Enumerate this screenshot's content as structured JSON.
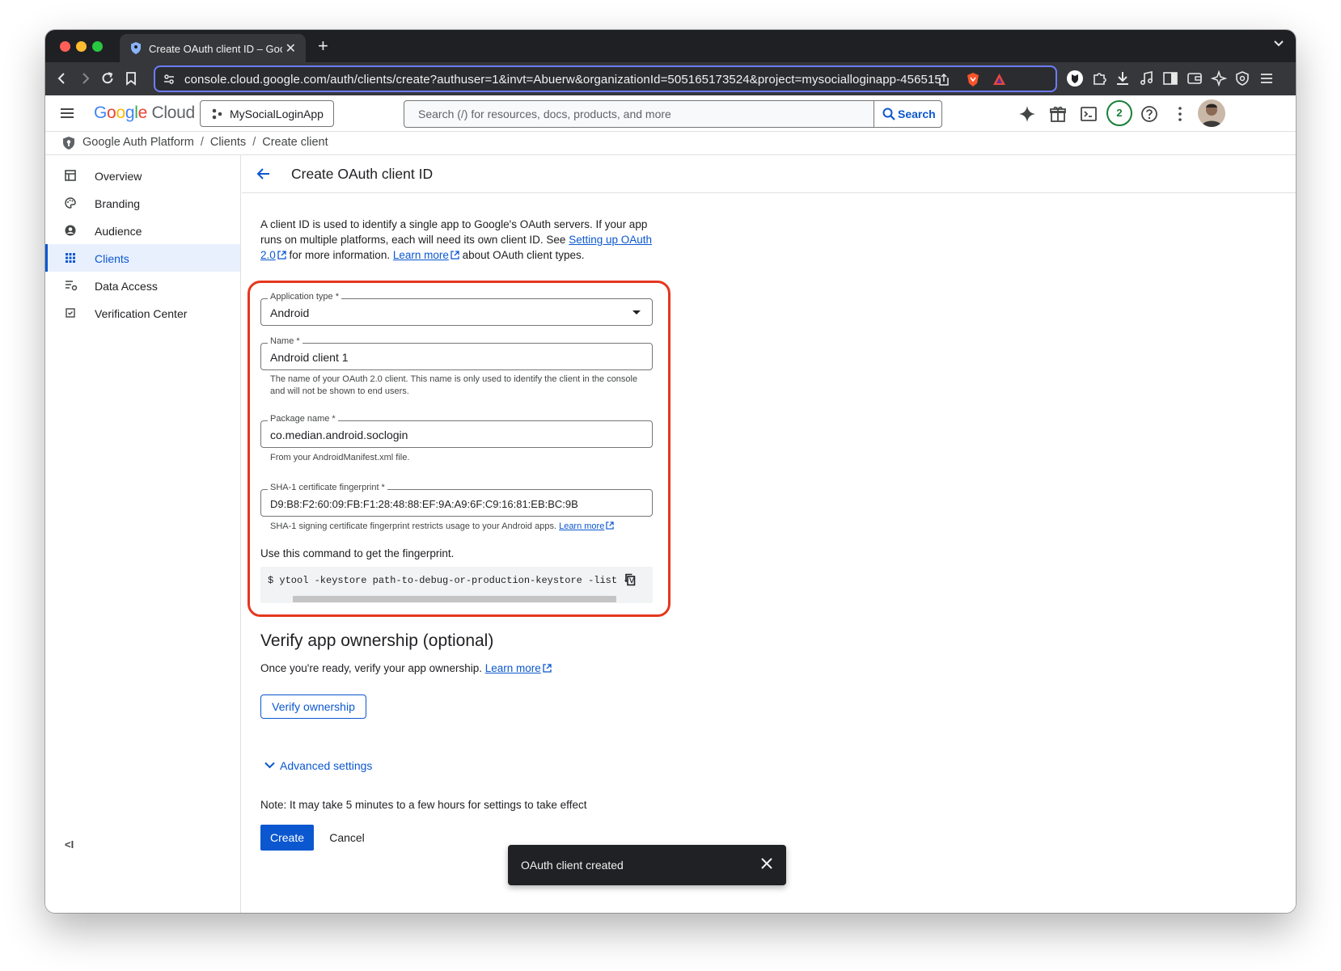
{
  "browser": {
    "tab_title": "Create OAuth client ID – Google Cloud",
    "url": "console.cloud.google.com/auth/clients/create?authuser=1&invt=Abuerw&organizationId=505165173524&project=mysocialloginapp-456515"
  },
  "header": {
    "logo_google": "Google",
    "logo_cloud": "Cloud",
    "project": "MySocialLoginApp",
    "search_placeholder": "Search (/) for resources, docs, products, and more",
    "search_button": "Search",
    "notification_count": "2"
  },
  "breadcrumb": {
    "items": [
      "Google Auth Platform",
      "Clients",
      "Create client"
    ]
  },
  "sidebar": {
    "items": [
      {
        "label": "Overview",
        "icon": "dashboard-icon"
      },
      {
        "label": "Branding",
        "icon": "palette-icon"
      },
      {
        "label": "Audience",
        "icon": "person-icon"
      },
      {
        "label": "Clients",
        "icon": "grid-icon",
        "active": true
      },
      {
        "label": "Data Access",
        "icon": "data-access-icon"
      },
      {
        "label": "Verification Center",
        "icon": "checkbox-icon"
      }
    ],
    "collapse_label": "<I"
  },
  "main": {
    "title": "Create OAuth client ID",
    "intro_1": "A client ID is used to identify a single app to Google's OAuth servers. If your app runs on multiple platforms, each will need its own client ID. See ",
    "intro_link_1": "Setting up OAuth 2.0",
    "intro_2": " for more information. ",
    "intro_link_2": "Learn more",
    "intro_3": " about OAuth client types.",
    "form": {
      "app_type_label": "Application type *",
      "app_type_value": "Android",
      "name_label": "Name *",
      "name_value": "Android client 1",
      "name_helper": "The name of your OAuth 2.0 client. This name is only used to identify the client in the console and will not be shown to end users.",
      "package_label": "Package name *",
      "package_value": "co.median.android.soclogin",
      "package_helper": "From your AndroidManifest.xml file.",
      "sha_label": "SHA-1 certificate fingerprint *",
      "sha_value": "D9:B8:F2:60:09:FB:F1:28:48:88:EF:9A:A9:6F:C9:16:81:EB:BC:9B",
      "sha_helper": "SHA-1 signing certificate fingerprint restricts usage to your Android apps. ",
      "sha_helper_link": "Learn more",
      "command_label": "Use this command to get the fingerprint.",
      "command": "$  ytool -keystore path-to-debug-or-production-keystore -list -v"
    },
    "verify": {
      "heading": "Verify app ownership (optional)",
      "text": "Once you're ready, verify your app ownership. ",
      "link": "Learn more",
      "button": "Verify ownership"
    },
    "advanced": "Advanced settings",
    "note": "Note: It may take 5 minutes to a few hours for settings to take effect",
    "create": "Create",
    "cancel": "Cancel"
  },
  "toast": {
    "message": "OAuth client created"
  },
  "colors": {
    "accent": "#0b57d0",
    "highlight": "#e5371e",
    "badge": "#188038"
  }
}
